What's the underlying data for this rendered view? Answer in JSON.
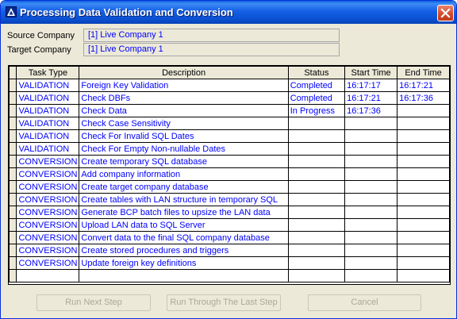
{
  "window": {
    "title": "Processing Data Validation and Conversion"
  },
  "source": {
    "label": "Source Company",
    "value": "[1] Live Company 1"
  },
  "target": {
    "label": "Target Company",
    "value": "[1] Live Company 1"
  },
  "grid": {
    "headers": {
      "task_type": "Task Type",
      "description": "Description",
      "status": "Status",
      "start_time": "Start Time",
      "end_time": "End Time"
    },
    "rows": [
      {
        "task_type": "VALIDATION",
        "description": "Foreign Key Validation",
        "status": "Completed",
        "start_time": "16:17:17",
        "end_time": "16:17:21"
      },
      {
        "task_type": "VALIDATION",
        "description": "Check DBFs",
        "status": "Completed",
        "start_time": "16:17:21",
        "end_time": "16:17:36"
      },
      {
        "task_type": "VALIDATION",
        "description": "Check Data",
        "status": "In Progress",
        "start_time": "16:17:36",
        "end_time": ""
      },
      {
        "task_type": "VALIDATION",
        "description": "Check Case Sensitivity",
        "status": "",
        "start_time": "",
        "end_time": ""
      },
      {
        "task_type": "VALIDATION",
        "description": "Check For Invalid SQL Dates",
        "status": "",
        "start_time": "",
        "end_time": ""
      },
      {
        "task_type": "VALIDATION",
        "description": "Check For Empty Non-nullable Dates",
        "status": "",
        "start_time": "",
        "end_time": ""
      },
      {
        "task_type": "CONVERSION",
        "description": "Create temporary SQL database",
        "status": "",
        "start_time": "",
        "end_time": ""
      },
      {
        "task_type": "CONVERSION",
        "description": "Add company information",
        "status": "",
        "start_time": "",
        "end_time": ""
      },
      {
        "task_type": "CONVERSION",
        "description": "Create target company database",
        "status": "",
        "start_time": "",
        "end_time": ""
      },
      {
        "task_type": "CONVERSION",
        "description": "Create tables with LAN structure in temporary SQL",
        "status": "",
        "start_time": "",
        "end_time": ""
      },
      {
        "task_type": "CONVERSION",
        "description": "Generate BCP batch files to upsize the LAN data",
        "status": "",
        "start_time": "",
        "end_time": ""
      },
      {
        "task_type": "CONVERSION",
        "description": "Upload LAN data to SQL Server",
        "status": "",
        "start_time": "",
        "end_time": ""
      },
      {
        "task_type": "CONVERSION",
        "description": "Convert data to the final SQL company database",
        "status": "",
        "start_time": "",
        "end_time": ""
      },
      {
        "task_type": "CONVERSION",
        "description": "Create stored procedures and triggers",
        "status": "",
        "start_time": "",
        "end_time": ""
      },
      {
        "task_type": "CONVERSION",
        "description": "Update foreign key definitions",
        "status": "",
        "start_time": "",
        "end_time": ""
      },
      {
        "task_type": "",
        "description": "",
        "status": "",
        "start_time": "",
        "end_time": ""
      }
    ]
  },
  "buttons": {
    "run_next": "Run Next Step",
    "run_through": "Run Through The Last Step",
    "cancel": "Cancel"
  },
  "colors": {
    "title_bar": "#1560e6",
    "cell_text": "#0000ff",
    "window_bg": "#ece9d8",
    "disabled_text": "#aca899"
  }
}
